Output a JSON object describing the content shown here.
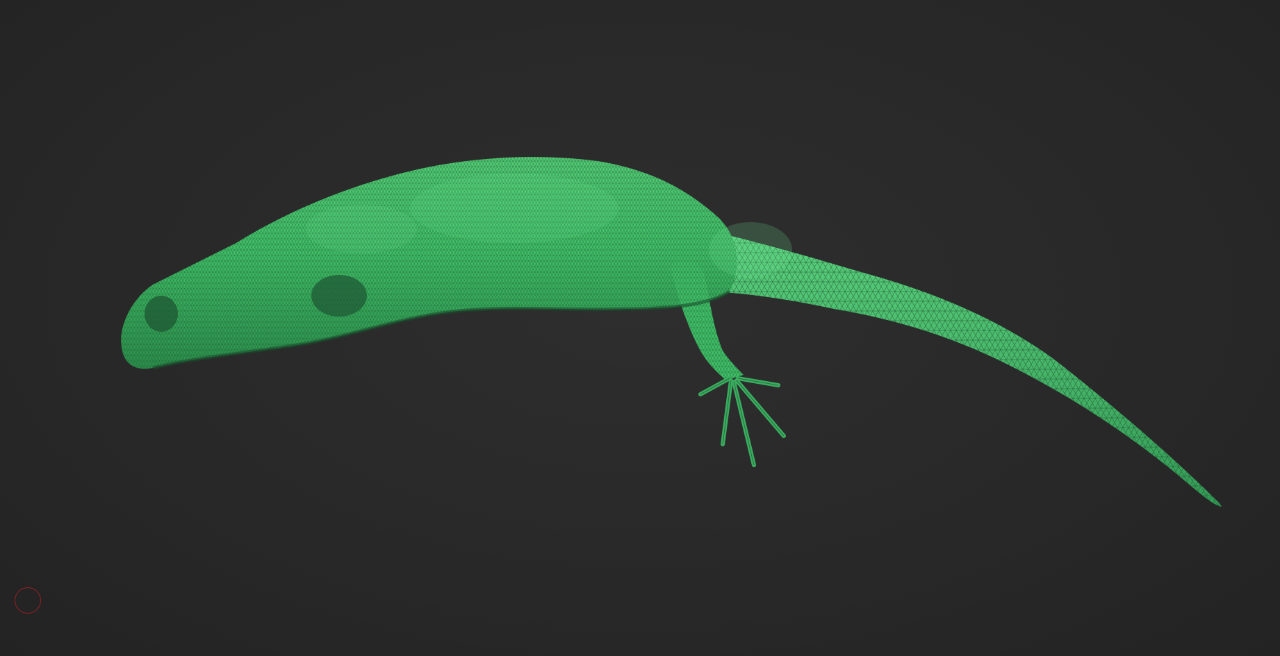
{
  "viewport": {
    "background_color": "#2a2a2a"
  },
  "model": {
    "description_icon": "lizard-mesh-model",
    "mesh_color": "#3fbf67",
    "wire_color": "#1c4a2a",
    "highlight_color": "#6fe08f",
    "shadow_color": "#1e5a33"
  },
  "gizmo": {
    "icon": "circle-icon",
    "color": "#9a1f24"
  }
}
